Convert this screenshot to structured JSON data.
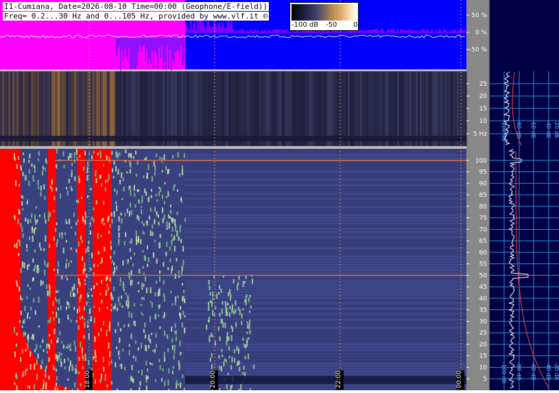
{
  "header": {
    "line1": "I1-Cumiana, Date=2026-08-10 Time=00:00 (Geophone/E-field))",
    "line2": "Freq= 0.2...30 Hz and 0...105 Hz, provided by www.vlf.it ©"
  },
  "colorbar": {
    "labels": [
      "-100 dB",
      "-50",
      "0"
    ]
  },
  "chart_data": [
    {
      "type": "line",
      "panel": "amplitude strip",
      "yticks": [
        "50 %",
        "0 %",
        "-50 %"
      ],
      "colors": {
        "fill": "#ff00ff",
        "background": "#0000ff",
        "trace": "#e0e0ff"
      }
    },
    {
      "type": "heatmap",
      "panel": "low-frequency spectrogram",
      "yticks": [
        "25",
        "20",
        "15",
        "10",
        "5 Hz"
      ],
      "ylim": [
        0.2,
        30
      ]
    },
    {
      "type": "heatmap",
      "panel": "main spectrogram",
      "yticks": [
        "100",
        "95",
        "90",
        "85",
        "80",
        "75",
        "70",
        "65",
        "60",
        "55",
        "50",
        "45",
        "40",
        "35",
        "30",
        "25",
        "20",
        "15",
        "10",
        "5"
      ],
      "ylim": [
        0,
        105
      ],
      "xticks": [
        "18:00",
        "20:00",
        "22:00",
        "00:00"
      ],
      "interference_lines_hz": [
        50,
        100
      ]
    },
    {
      "type": "line",
      "panel": "side spectrum",
      "xticks_upper": [
        "-100 dB",
        "-80 dB",
        "-60 dB",
        "-40 dB",
        "-20 dB"
      ],
      "xticks_lower": [
        "-100 dB",
        "-80 dB",
        "-60 dB",
        "-40 dB",
        "-20 dB"
      ]
    }
  ],
  "colors": {
    "page_bg": "#ffffff",
    "gray_axis": "#888888",
    "navy": "#000044",
    "grid_cyan": "#2f8fd0",
    "spectro_blue": "#38407e",
    "saturated_red": "#ff0000",
    "magenta": "#ff00ff"
  }
}
